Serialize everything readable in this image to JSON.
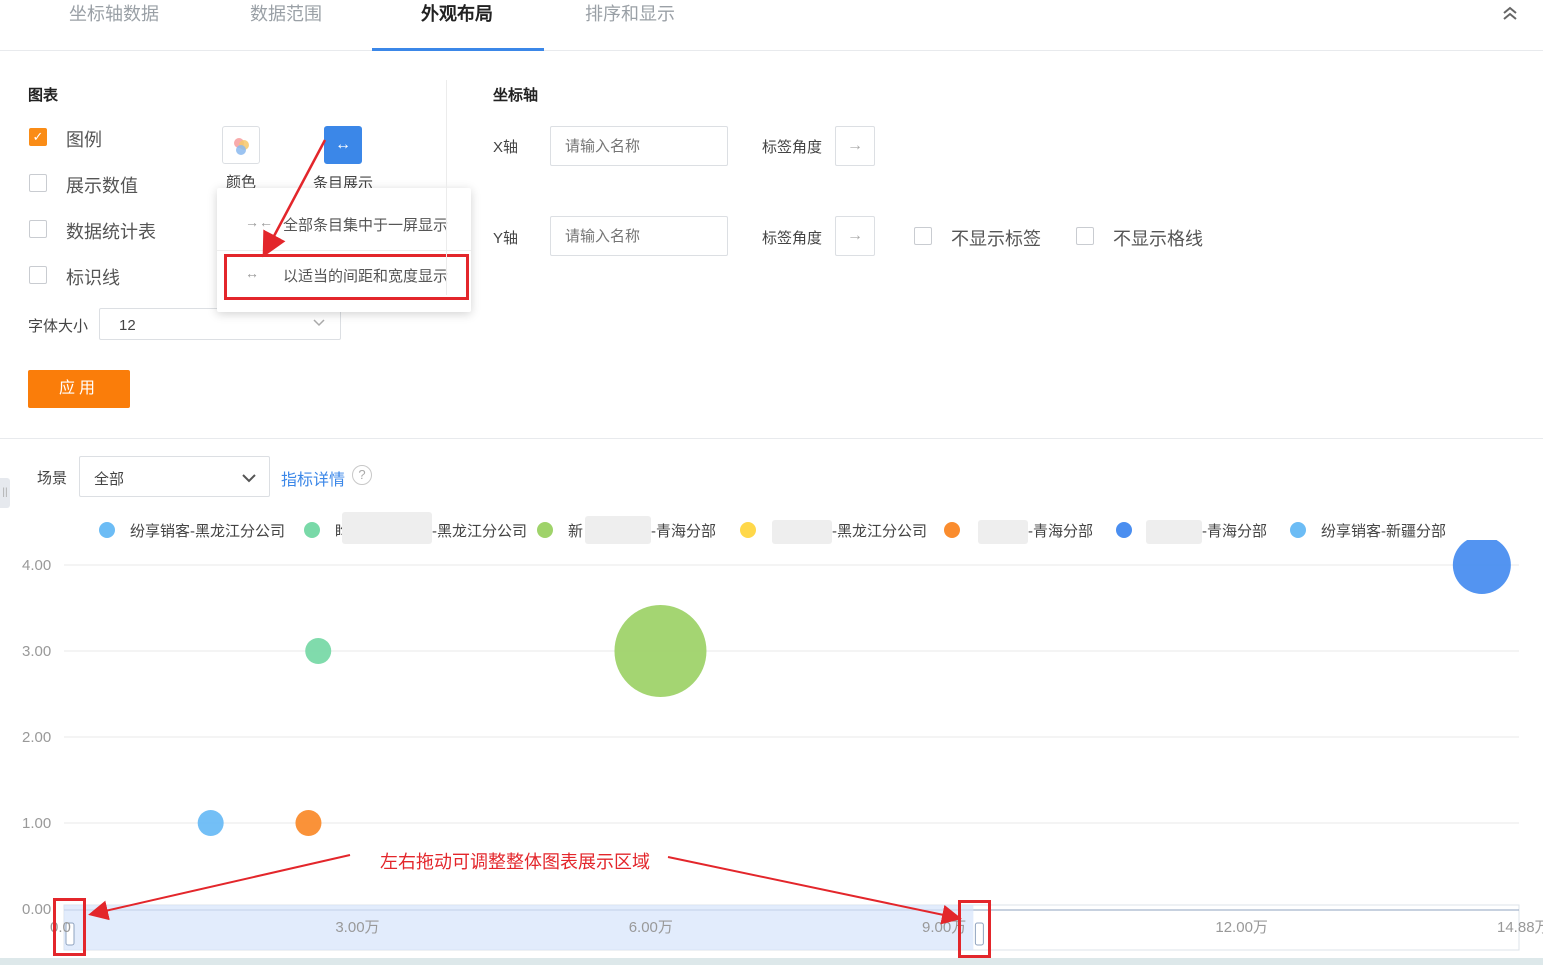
{
  "tabs": [
    {
      "label": "坐标轴数据",
      "active": false
    },
    {
      "label": "数据范围",
      "active": false
    },
    {
      "label": "外观布局",
      "active": true
    },
    {
      "label": "排序和显示",
      "active": false
    }
  ],
  "chart_panel": {
    "title": "图表",
    "options": [
      {
        "label": "图例",
        "checked": true
      },
      {
        "label": "展示数值",
        "checked": false
      },
      {
        "label": "数据统计表",
        "checked": false
      },
      {
        "label": "标识线",
        "checked": false
      }
    ],
    "color_label": "颜色",
    "items_label": "条目展示",
    "font_size_label": "字体大小",
    "font_size_value": "12",
    "apply_label": "应用"
  },
  "items_dropdown": {
    "options": [
      {
        "icon": "compress-arrows-icon",
        "label": "全部条目集中于一屏显示"
      },
      {
        "icon": "expand-arrows-icon",
        "label": "以适当的间距和宽度显示"
      }
    ]
  },
  "axis_panel": {
    "title": "坐标轴",
    "x_label": "X轴",
    "y_label": "Y轴",
    "name_placeholder": "请输入名称",
    "angle_label": "标签角度",
    "hide_labels": "不显示标签",
    "hide_grid": "不显示格线"
  },
  "scene": {
    "label": "场景",
    "value": "全部",
    "detail_link": "指标详情",
    "help": "?"
  },
  "colors": {
    "accent": "#fa8c16",
    "primary": "#3b87e8",
    "annotation": "#e3262b"
  },
  "annotation": {
    "text": "左右拖动可调整整体图表展示区域"
  },
  "chart_data": {
    "type": "scatter",
    "legend_placement": "top",
    "series": [
      {
        "name": "纷享销客-黑龙江分公司",
        "color": "#6cbcf5",
        "points": [
          [
            1.5,
            1.0
          ]
        ]
      },
      {
        "name": "-黑龙江分公司",
        "prefix": "盷",
        "color": "#79d9a8",
        "points": [
          [
            2.6,
            3.0
          ]
        ]
      },
      {
        "name": "-青海分部",
        "prefix": "新",
        "color": "#9fd36a",
        "points": [
          [
            6.1,
            3.0
          ]
        ]
      },
      {
        "name": "-黑龙江分公司",
        "prefix": "",
        "color": "#ffd84a",
        "points": []
      },
      {
        "name": "-青海分部",
        "prefix": "",
        "color": "#fa8c2e",
        "points": [
          [
            2.5,
            1.0
          ]
        ]
      },
      {
        "name": "-青海分部",
        "prefix": "",
        "color": "#4a8ef0",
        "points": [
          [
            14.5,
            4.0
          ]
        ]
      },
      {
        "name": "纷享销客-新疆分部",
        "color": "#6cbcf5",
        "points": []
      }
    ],
    "bubble_sizes": [
      26,
      26,
      92,
      0,
      26,
      58,
      0
    ],
    "y_ticks": [
      "0.00",
      "1.00",
      "2.00",
      "3.00",
      "4.00"
    ],
    "ylim": [
      0,
      4
    ],
    "x_ticks": [
      "0.0",
      "3.00万",
      "6.00万",
      "9.00万",
      "12.00万",
      "14.88万"
    ],
    "x_tick_values": [
      0,
      3,
      6,
      9,
      12,
      14.88
    ],
    "xlim": [
      0,
      14.88
    ],
    "grid": true,
    "slider_range": [
      0,
      9.3
    ]
  }
}
